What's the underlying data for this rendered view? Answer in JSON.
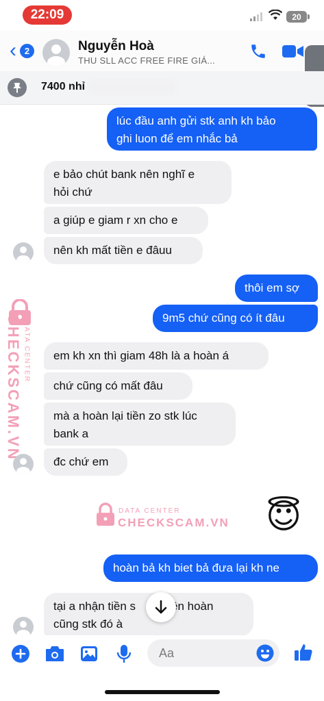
{
  "status_bar": {
    "time": "22:09",
    "battery": "20"
  },
  "header": {
    "back_badge": "2",
    "contact_name": "Nguyễn Hoà",
    "subtitle": "THU SLL ACC FREE FIRE GIÁ..."
  },
  "pinned": {
    "text": "7400 nhỉ"
  },
  "messages": [
    {
      "side": "out",
      "text": "lúc đầu anh gửi stk anh kh bảo\nghi luon để em nhắc bả"
    },
    {
      "side": "in",
      "text": "e bảo chút bank nên nghĩ e\nhỏi chứ"
    },
    {
      "side": "in",
      "text": "a giúp e giam r xn cho e"
    },
    {
      "side": "in",
      "text": "nên kh mất tiền e đâuu"
    },
    {
      "side": "out",
      "text": "thôi em sợ"
    },
    {
      "side": "out",
      "text": "9m5 chứ cũng có ít đâu"
    },
    {
      "side": "in",
      "text": "em kh xn thì giam 48h là a hoàn á"
    },
    {
      "side": "in",
      "text": "chứ cũng có mất đâu"
    },
    {
      "side": "in",
      "text": "mà a hoàn lại tiền zo stk lúc\nbank a"
    },
    {
      "side": "in",
      "text": "đc chứ em"
    },
    {
      "side": "in",
      "emoji": "😇"
    },
    {
      "side": "out",
      "text": "hoàn bả kh biet bả đưa lại kh ne"
    },
    {
      "side": "in",
      "text": "tại a nhận tiền s      ó nên hoàn\ncũng stk đó à"
    }
  ],
  "watermark": {
    "side_brand": "CHECKSCAM.VN",
    "side_label": "DATA CENTER",
    "center_label": "DATA CENTER",
    "center_brand": "CHECKSCAM.VN"
  },
  "composer": {
    "placeholder": "Aa"
  },
  "colors": {
    "accent": "#1560f5",
    "incoming": "#efeff2",
    "watermark": "#f3a0b7"
  },
  "icons": [
    "back-chevron-icon",
    "phone-icon",
    "video-icon",
    "pin-icon",
    "plus-icon",
    "camera-icon",
    "gallery-icon",
    "mic-icon",
    "emoji-icon",
    "like-icon",
    "arrow-down-icon",
    "lock-icon"
  ]
}
